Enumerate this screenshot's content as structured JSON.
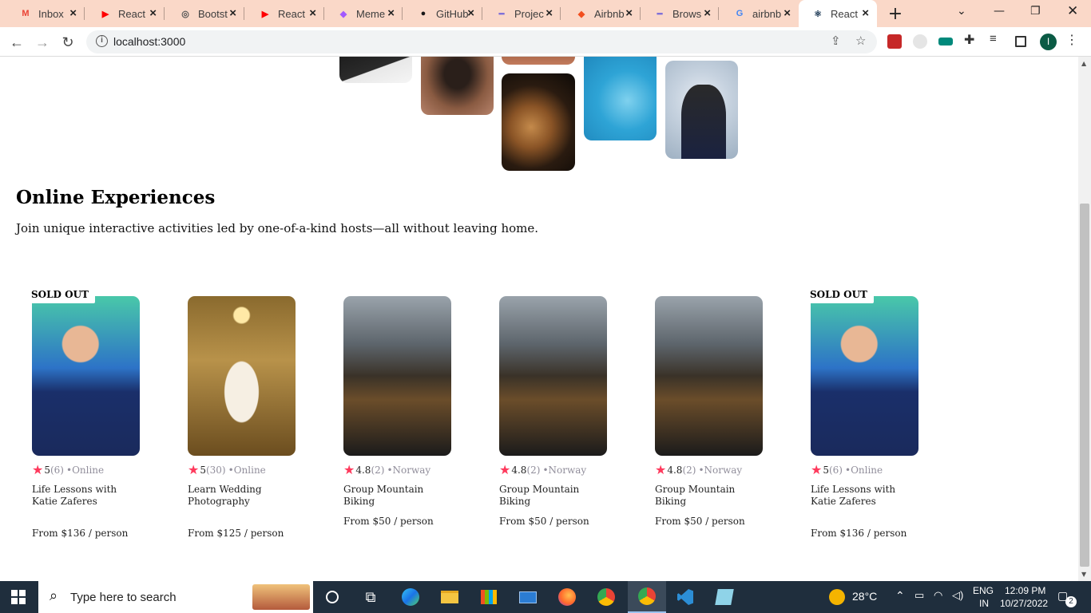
{
  "browser": {
    "tabs": [
      {
        "label": "Inbox",
        "icon": "gmail-icon",
        "glyph": "M",
        "color": "#ea4335",
        "active": false
      },
      {
        "label": "React",
        "icon": "youtube-icon",
        "glyph": "▶",
        "color": "#ff0000",
        "active": false
      },
      {
        "label": "Bootst",
        "icon": "bootstrap-icon",
        "glyph": "◎",
        "color": "#555555",
        "active": false
      },
      {
        "label": "React",
        "icon": "youtube-icon",
        "glyph": "▶",
        "color": "#ff0000",
        "active": false
      },
      {
        "label": "Meme",
        "icon": "figma-icon",
        "glyph": "◆",
        "color": "#a259ff",
        "active": false
      },
      {
        "label": "GitHub",
        "icon": "github-icon",
        "glyph": "●",
        "color": "#181717",
        "active": false
      },
      {
        "label": "Projec",
        "icon": "page-icon",
        "glyph": "━",
        "color": "#7b6cd9",
        "active": false
      },
      {
        "label": "Airbnb",
        "icon": "figma-icon",
        "glyph": "◆",
        "color": "#f24e1e",
        "active": false
      },
      {
        "label": "Brows",
        "icon": "page-icon",
        "glyph": "━",
        "color": "#7b6cd9",
        "active": false
      },
      {
        "label": "airbnb",
        "icon": "google-icon",
        "glyph": "G",
        "color": "#4285f4",
        "active": false
      },
      {
        "label": "React",
        "icon": "react-icon",
        "glyph": "⚛",
        "color": "#1e3a56",
        "active": true
      }
    ],
    "url": "localhost:3000"
  },
  "page": {
    "section_title": "Online Experiences",
    "section_subtitle": "Join unique interactive activities led by one-of-a-kind hosts—all without leaving home.",
    "cards": [
      {
        "badge": "SOLD OUT",
        "rating": "5",
        "count": "(6)",
        "location": "•Online",
        "title": "Life Lessons with Katie Zaferes",
        "price": "From $136 / person",
        "image": "swimmer-athlete-photo"
      },
      {
        "badge": "",
        "rating": "5",
        "count": "(30)",
        "location": "•Online",
        "title": "Learn Wedding Photography",
        "price": "From $125 / person",
        "image": "wedding-bride-photo"
      },
      {
        "badge": "",
        "rating": "4.8",
        "count": "(2)",
        "location": "•Norway",
        "title": "Group Mountain Biking",
        "price": "From $50 / person",
        "image": "mountain-bike-photo"
      },
      {
        "badge": "",
        "rating": "4.8",
        "count": "(2)",
        "location": "•Norway",
        "title": "Group Mountain Biking",
        "price": "From $50 / person",
        "image": "mountain-bike-photo"
      },
      {
        "badge": "",
        "rating": "4.8",
        "count": "(2)",
        "location": "•Norway",
        "title": "Group Mountain Biking",
        "price": "From $50 / person",
        "image": "mountain-bike-photo"
      },
      {
        "badge": "SOLD OUT",
        "rating": "5",
        "count": "(6)",
        "location": "•Online",
        "title": "Life Lessons with Katie Zaferes",
        "price": "From $136 / person",
        "image": "swimmer-athlete-photo"
      }
    ]
  },
  "taskbar": {
    "search_placeholder": "Type here to search",
    "weather": "28°C",
    "language_top": "ENG",
    "language_bottom": "IN",
    "time": "12:09 PM",
    "date": "10/27/2022",
    "notifications": "2"
  }
}
